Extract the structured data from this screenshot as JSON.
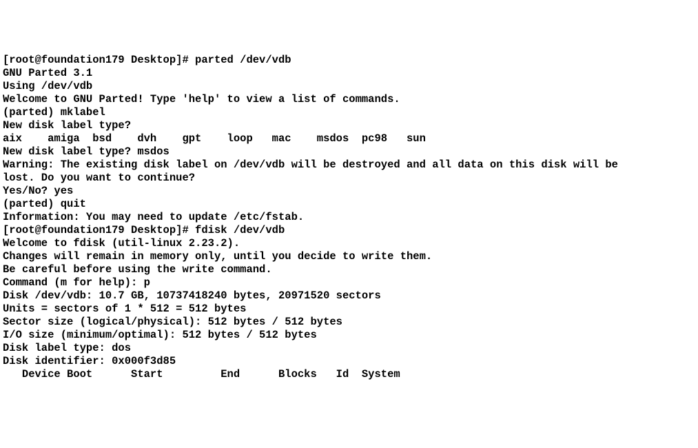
{
  "lines": [
    "[root@foundation179 Desktop]# parted /dev/vdb",
    "GNU Parted 3.1",
    "Using /dev/vdb",
    "Welcome to GNU Parted! Type 'help' to view a list of commands.",
    "(parted) mklabel",
    "New disk label type?",
    "aix    amiga  bsd    dvh    gpt    loop   mac    msdos  pc98   sun",
    "New disk label type? msdos",
    "Warning: The existing disk label on /dev/vdb will be destroyed and all data on this disk will be",
    "lost. Do you want to continue?",
    "Yes/No? yes",
    "(parted) quit",
    "Information: You may need to update /etc/fstab.",
    "",
    "[root@foundation179 Desktop]# fdisk /dev/vdb",
    "Welcome to fdisk (util-linux 2.23.2).",
    "",
    "Changes will remain in memory only, until you decide to write them.",
    "Be careful before using the write command.",
    "",
    "",
    "Command (m for help): p",
    "",
    "Disk /dev/vdb: 10.7 GB, 10737418240 bytes, 20971520 sectors",
    "Units = sectors of 1 * 512 = 512 bytes",
    "Sector size (logical/physical): 512 bytes / 512 bytes",
    "I/O size (minimum/optimal): 512 bytes / 512 bytes",
    "Disk label type: dos",
    "Disk identifier: 0x000f3d85",
    "",
    "   Device Boot      Start         End      Blocks   Id  System"
  ]
}
